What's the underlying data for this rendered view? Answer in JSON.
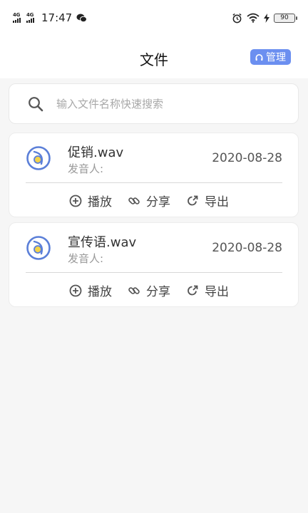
{
  "status_bar": {
    "network1": "4G",
    "network2": "4G",
    "time": "17:47",
    "battery": "90"
  },
  "header": {
    "title": "文件",
    "manage_label": "管理"
  },
  "search": {
    "placeholder": "输入文件名称快速搜索"
  },
  "files": [
    {
      "name": "促销.wav",
      "speaker_label": "发音人:",
      "date": "2020-08-28",
      "actions": {
        "play": "播放",
        "share": "分享",
        "export": "导出"
      }
    },
    {
      "name": "宣传语.wav",
      "speaker_label": "发音人:",
      "date": "2020-08-28",
      "actions": {
        "play": "播放",
        "share": "分享",
        "export": "导出"
      }
    }
  ],
  "colors": {
    "accent": "#6b8ff0",
    "icon_blue": "#5b7fd8",
    "icon_yellow": "#f3d34a"
  },
  "icons": {
    "search": "search-icon",
    "play": "plus-circle-icon",
    "share": "link-icon",
    "export": "export-arrow-icon",
    "file": "audio-disc-icon",
    "manage": "headphones-icon"
  }
}
